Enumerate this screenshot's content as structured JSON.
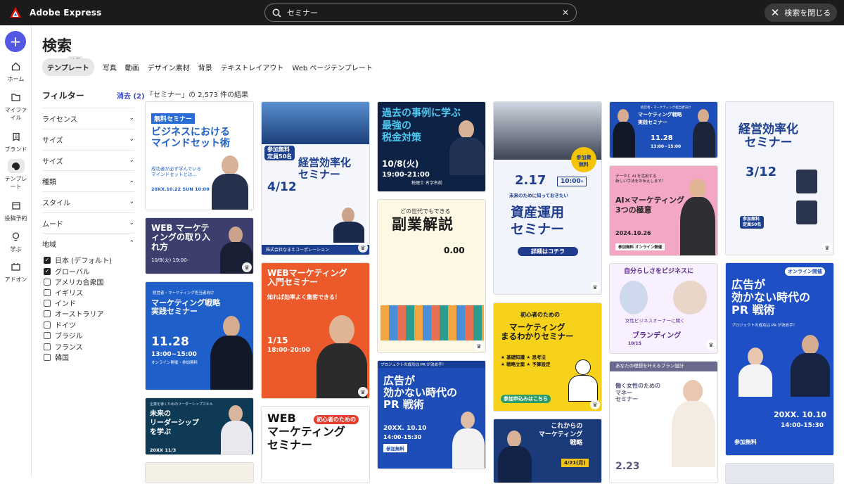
{
  "app": {
    "name": "Adobe Express"
  },
  "search": {
    "value": "セミナー",
    "close_label": "検索を閉じる"
  },
  "rail": [
    {
      "label": "ホーム",
      "icon": "home-icon"
    },
    {
      "label": "マイファイル",
      "icon": "folder-icon"
    },
    {
      "label": "ブランド",
      "icon": "brand-icon"
    },
    {
      "label": "テンプレート",
      "icon": "template-icon"
    },
    {
      "label": "投稿予約",
      "icon": "calendar-icon"
    },
    {
      "label": "学ぶ",
      "icon": "lightbulb-icon"
    },
    {
      "label": "アドオン",
      "icon": "addon-icon"
    }
  ],
  "page": {
    "title": "検索",
    "tooltip": "検索"
  },
  "tabs": [
    "テンプレート",
    "写真",
    "動画",
    "デザイン素材",
    "背景",
    "テキストレイアウト",
    "Web ページテンプレート"
  ],
  "filters": {
    "title": "フィルター",
    "clear": "消去 (2)",
    "facets": [
      "ライセンス",
      "サイズ",
      "サイズ",
      "種類",
      "スタイル",
      "ムード",
      "地域"
    ],
    "region_options": [
      {
        "label": "日本 (デフォルト)",
        "checked": true
      },
      {
        "label": "グローバル",
        "checked": true
      },
      {
        "label": "アメリカ合衆国",
        "checked": false
      },
      {
        "label": "イギリス",
        "checked": false
      },
      {
        "label": "インド",
        "checked": false
      },
      {
        "label": "オーストラリア",
        "checked": false
      },
      {
        "label": "ドイツ",
        "checked": false
      },
      {
        "label": "ブラジル",
        "checked": false
      },
      {
        "label": "フランス",
        "checked": false
      },
      {
        "label": "韓国",
        "checked": false
      }
    ]
  },
  "results": {
    "count_text": "「セミナー」の 2,573 件の結果"
  },
  "cards": {
    "c1": {
      "badge": "無料セミナー",
      "title": "ビジネスにおける\nマインドセット術",
      "sub": "成功者が必ず学んでいる\nマインドセットとは…",
      "date": "20XX.10.22 SUN 10:00"
    },
    "c2": {
      "title": "WEB\nマーケティングの取り入れ方",
      "sub": "10/8(火) 19:00-"
    },
    "c3": {
      "badge": "経営者・マーケティング担当者向け",
      "title": "マーケティング戦略\n実践セミナー",
      "date": "11.28",
      "time": "13:00~15:00",
      "sub": "オンライン開催・参加無料"
    },
    "c4": {
      "title": "未来の\nリーダーシップ\nを学ぶ",
      "date": "20XX 11/3",
      "sub": "企業を導くためのリーダーシップスキル"
    },
    "c5": {
      "badge": "参加無料\n定員50名",
      "title": "経営効率化\nセミナー",
      "date": "4/12",
      "sub": "株式会社なまえコーポレーション"
    },
    "c6": {
      "title": "WEBマーケティング\n入門セミナー",
      "sub": "知れば効率よく集客できる！",
      "date": "1/15",
      "time": "18:00-20:00"
    },
    "c7": {
      "title": "WEB\nマーケティング\nセミナー",
      "badge": "初心者のための"
    },
    "c8": {
      "title": "過去の事例に学ぶ\n最強の\n税金対策",
      "date": "10/8(火)",
      "time": "19:00-21:00",
      "sub": "税理士 名字名前"
    },
    "c9": {
      "title": "副業解説",
      "sub": "どの世代でもできる",
      "badge": "0.00"
    },
    "c10": {
      "badge": "プロジェクトの成功は PR が決め手！",
      "title": "広告が\n効かない時代の\nPR 戦術",
      "date": "20XX. 10.10",
      "time": "14:00-15:30",
      "sub": "参加無料"
    },
    "c11": {
      "badge": "参加費\n無料",
      "date": "2.17",
      "time": "10:00-",
      "title": "資産運用\nセミナー",
      "sub": "未来のために知っておきたい",
      "cta": "詳細はコチラ"
    },
    "c12": {
      "badge": "初心者のための",
      "title": "マーケティング\nまるわかりセミナー",
      "sub": "★ 基礎知識 ★ 思考法\n★ 戦略立案 ★ 予算設定",
      "cta": "参加申込みはこちら"
    },
    "c13": {
      "title": "これからの\nマーケティング\n戦略",
      "date": "4/21(月)"
    },
    "c14": {
      "badge": "経営者・マーケティング担当者向け",
      "title": "マーケティング戦略\n実践セミナー",
      "date": "11.28",
      "time": "13:00~15:00"
    },
    "c15": {
      "title": "AI×マーケティング\n3つの極意",
      "sub": "データと AI を活用する\n新しい手法をお伝えします！",
      "date": "2024.10.26",
      "badge": "参加無料 オンライン開催"
    },
    "c16": {
      "title": "自分らしさをビジネスに",
      "sub": "女性ビジネスオーナーに聞く",
      "badge": "ブランディング",
      "date": "10/15"
    },
    "c17": {
      "sub": "あなたの理想を叶えるプラン設計",
      "title": "働く女性のための\nマネー\nセミナー",
      "date": "2.23"
    },
    "c18": {
      "title": "経営効率化\nセミナー",
      "date": "3/12",
      "badge": "参加無料\n定員50名"
    },
    "c19": {
      "badge": "オンライン開催",
      "title": "広告が\n効かない時代の\nPR 戦術",
      "sub": "プロジェクトの成功は PR が決め手！",
      "date": "20XX. 10.10",
      "time": "14:00-15:30",
      "cta": "参加無料"
    }
  },
  "colors": {
    "accent": "#5258e4",
    "topbar": "#1b1b1b"
  }
}
